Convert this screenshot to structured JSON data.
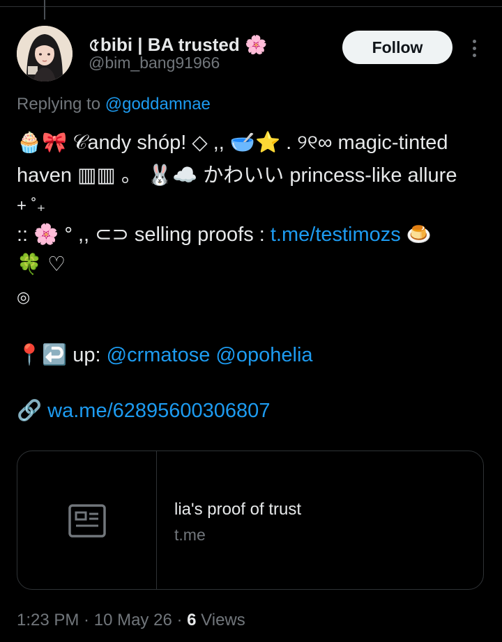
{
  "tweet": {
    "author": {
      "display_name": "৫bibi | BA trusted 🌸",
      "handle": "@bim_bang91966"
    },
    "follow_label": "Follow",
    "replying_prefix": "Replying to",
    "replying_to": "@goddamnae",
    "lines": {
      "l1": "🧁🎀 𝒞andy shóp! ◇ ,, 🥣⭐ . ୨୧∞ magic-tinted",
      "l2": "haven ▥▥ 。 🐰☁️ かわいい princess-like allure",
      "l3": "+ ˚₊",
      "l4_pre": ":: 🌸 ° ,, ⊂⊃ selling proofs : ",
      "l4_link": "t.me/testimozs",
      "l4_post": " 🍮",
      "l5": "🍀 ♡",
      "l6": "◎",
      "l7_pre": "📍↩️ up: ",
      "l7_mention1": "@crmatose",
      "l7_mention2": "@opohelia",
      "l8_icon": "🔗",
      "l8_link": "wa.me/62895600306807"
    },
    "card": {
      "title": "lia's proof of trust",
      "domain": "t.me"
    },
    "meta": {
      "time": "1:23 PM",
      "date": "10 May 26",
      "views_count": "6",
      "views_label": "Views",
      "separator": " · "
    }
  },
  "colors": {
    "background": "#000000",
    "text": "#e7e9ea",
    "muted": "#71767b",
    "link": "#1d9bf0",
    "button_bg": "#eff3f4",
    "border": "#2f3336"
  }
}
